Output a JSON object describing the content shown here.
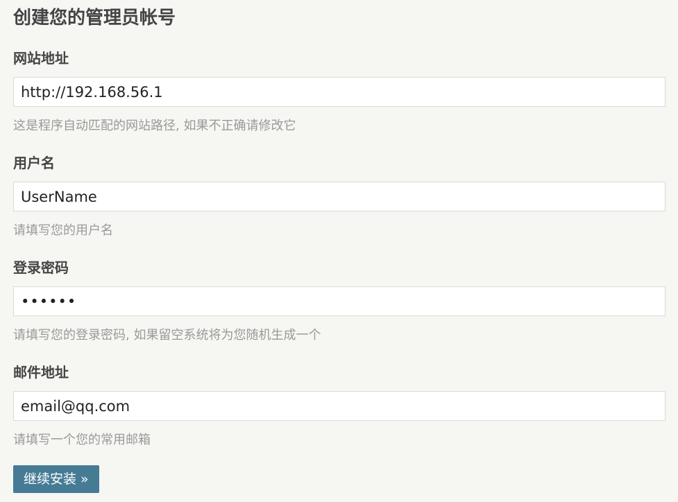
{
  "page_title": "创建您的管理员帐号",
  "fields": [
    {
      "label": "网站地址",
      "value": "http://192.168.56.1",
      "hint": "这是程序自动匹配的网站路径, 如果不正确请修改它"
    },
    {
      "label": "用户名",
      "value": "UserName",
      "hint": "请填写您的用户名"
    },
    {
      "label": "登录密码",
      "value": "••••••",
      "hint": "请填写您的登录密码, 如果留空系统将为您随机生成一个"
    },
    {
      "label": "邮件地址",
      "value": "email@qq.com",
      "hint": "请填写一个您的常用邮箱"
    }
  ],
  "submit_label": "继续安装 »",
  "colors": {
    "background": "#f6f6f3",
    "button": "#467b96",
    "hint_text": "#999999",
    "label_text": "#444444"
  }
}
